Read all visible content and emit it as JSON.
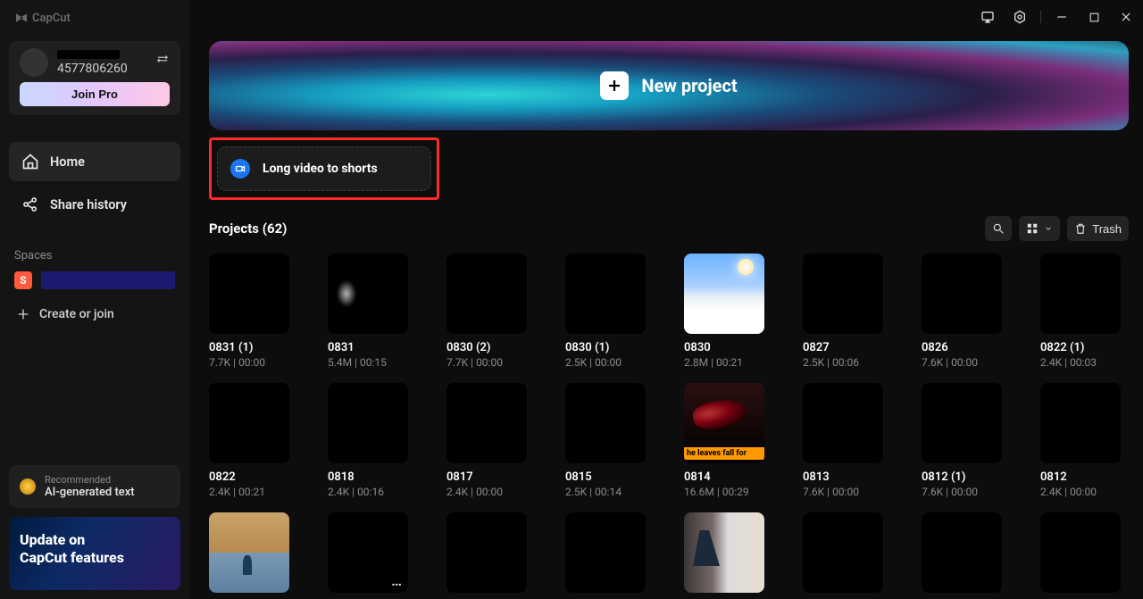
{
  "app": {
    "name": "CapCut",
    "user_id": "4577806260",
    "join_pro": "Join Pro"
  },
  "nav": {
    "home": "Home",
    "share_history": "Share history",
    "spaces_label": "Spaces",
    "create_or_join": "Create or join"
  },
  "space": {
    "badge": "S"
  },
  "recommend": {
    "top": "Recommended",
    "bottom": "AI-generated text"
  },
  "update_card": {
    "line1": "Update on",
    "line2": "CapCut features"
  },
  "hero": {
    "new_project": "New project"
  },
  "long_card": {
    "label": "Long video to shorts"
  },
  "projects_header": {
    "title": "Projects  (62)",
    "trash": "Trash"
  },
  "projects": [
    {
      "name": "0831 (1)",
      "meta": "7.7K | 00:00",
      "thumbClass": ""
    },
    {
      "name": "0831",
      "meta": "5.4M | 00:15",
      "thumbClass": "smoke"
    },
    {
      "name": "0830 (2)",
      "meta": "7.7K | 00:00",
      "thumbClass": ""
    },
    {
      "name": "0830 (1)",
      "meta": "2.5K | 00:00",
      "thumbClass": ""
    },
    {
      "name": "0830",
      "meta": "2.8M | 00:21",
      "thumbClass": "sky"
    },
    {
      "name": "0827",
      "meta": "2.5K | 00:06",
      "thumbClass": ""
    },
    {
      "name": "0826",
      "meta": "7.6K | 00:00",
      "thumbClass": ""
    },
    {
      "name": "0822 (1)",
      "meta": "2.4K | 00:03",
      "thumbClass": ""
    },
    {
      "name": "0822",
      "meta": "2.4K | 00:21",
      "thumbClass": ""
    },
    {
      "name": "0818",
      "meta": "2.4K | 00:16",
      "thumbClass": ""
    },
    {
      "name": "0817",
      "meta": "2.4K | 00:00",
      "thumbClass": ""
    },
    {
      "name": "0815",
      "meta": "2.5K | 00:14",
      "thumbClass": ""
    },
    {
      "name": "0814",
      "meta": "16.6M | 00:29",
      "thumbClass": "guitar",
      "caption": "he leaves fall for"
    },
    {
      "name": "0813",
      "meta": "7.6K | 00:00",
      "thumbClass": ""
    },
    {
      "name": "0812 (1)",
      "meta": "7.6K | 00:00",
      "thumbClass": ""
    },
    {
      "name": "0812",
      "meta": "2.4K | 00:00",
      "thumbClass": ""
    },
    {
      "name": "",
      "meta": "",
      "thumbClass": "beach"
    },
    {
      "name": "",
      "meta": "",
      "thumbClass": "",
      "showDots": true
    },
    {
      "name": "",
      "meta": "",
      "thumbClass": ""
    },
    {
      "name": "",
      "meta": "",
      "thumbClass": ""
    },
    {
      "name": "",
      "meta": "",
      "thumbClass": "office"
    },
    {
      "name": "",
      "meta": "",
      "thumbClass": ""
    },
    {
      "name": "",
      "meta": "",
      "thumbClass": ""
    },
    {
      "name": "",
      "meta": "",
      "thumbClass": ""
    }
  ]
}
